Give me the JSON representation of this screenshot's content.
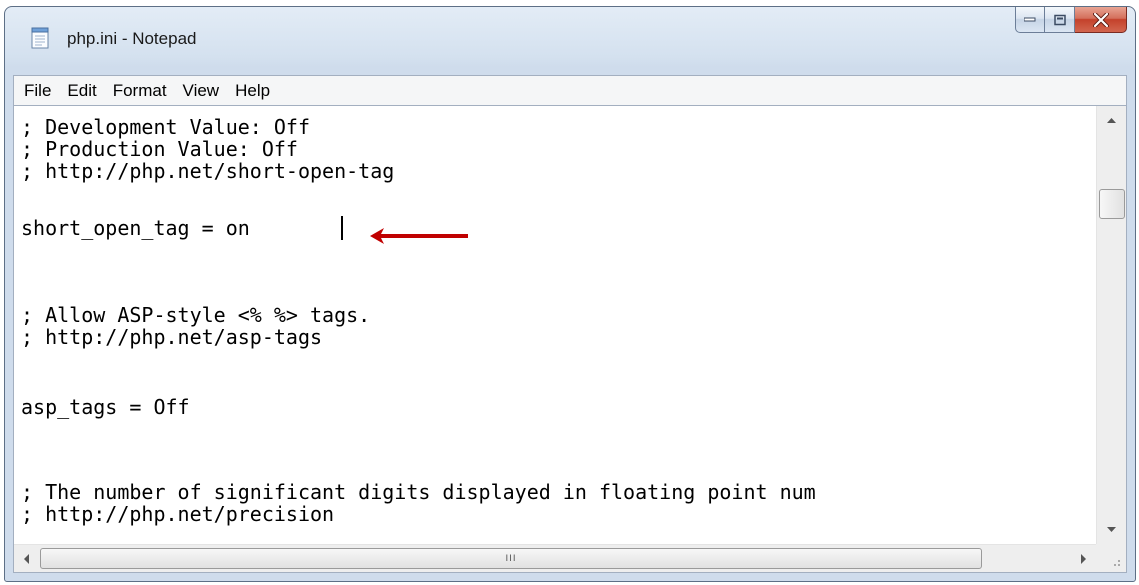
{
  "window": {
    "title": "php.ini - Notepad",
    "icon": "notepad-icon",
    "caption_buttons": [
      "minimize-icon",
      "maximize-icon",
      "close-icon"
    ]
  },
  "menu": {
    "items": [
      {
        "label": "File"
      },
      {
        "label": "Edit"
      },
      {
        "label": "Format"
      },
      {
        "label": "View"
      },
      {
        "label": "Help"
      }
    ]
  },
  "editor": {
    "lines": [
      "; Development Value: Off",
      "; Production Value: Off",
      "; http://php.net/short-open-tag",
      "short_open_tag = on",
      "; Allow ASP-style <% %> tags.",
      "; http://php.net/asp-tags",
      "asp_tags = Off",
      "; The number of significant digits displayed in floating point num",
      "; http://php.net/precision"
    ],
    "annotation": "red-arrow-icon",
    "annotation_color": "#c00000"
  },
  "scrollbars": {
    "horizontal_grip": "III"
  }
}
